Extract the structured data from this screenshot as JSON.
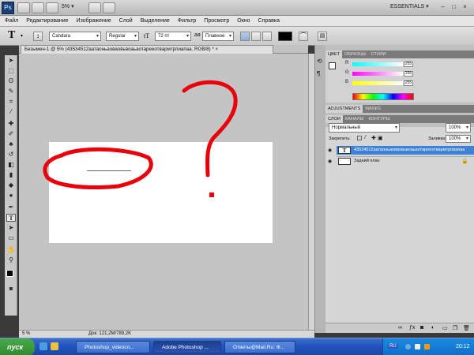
{
  "app_bar": {
    "logo": "Ps",
    "zoom": "5%",
    "workspace": "ESSENTIALS",
    "window_buttons": [
      "–",
      "□",
      "×"
    ]
  },
  "menu": [
    "Файл",
    "Редактирование",
    "Изображение",
    "Слой",
    "Выделение",
    "Фильтр",
    "Просмотр",
    "Окно",
    "Справка"
  ],
  "options_bar": {
    "tool_glyph": "T",
    "font_family": "Candara",
    "font_style": "Regular",
    "size_glyph": "tT",
    "font_size": "72 пт",
    "aa_label": "aa",
    "antialias": "Плавное",
    "text_color_hex": "#000000"
  },
  "document_tab": "Безымен-1 @ 5% (43534512аатаоньаоваовьвоаьаотарееотвармтрпиапаа, RGB/8) *",
  "status": {
    "zoom": "5 %",
    "doc_info": "Док: 121,2M/789,2K"
  },
  "color_panel": {
    "tabs": [
      "ЦВЕТ",
      "ОБРАЗЦЫ",
      "СТИЛИ"
    ],
    "channels": [
      {
        "label": "R",
        "value": "255"
      },
      {
        "label": "G",
        "value": "255"
      },
      {
        "label": "B",
        "value": "255"
      }
    ]
  },
  "adjustments_panel": {
    "tabs": [
      "ADJUSTMENTS",
      "MASKS"
    ]
  },
  "layers_panel": {
    "tabs": [
      "СЛОИ",
      "КАНАЛЫ",
      "КОНТУРЫ"
    ],
    "blend_mode": "Нормальный",
    "opacity": "100%",
    "lock_label": "Закрепить:",
    "fill_label": "Заливка:",
    "fill": "100%",
    "layers": [
      {
        "name": "43534512аатаоньаоваовьвоаьаотарееотвармтрпиапаа",
        "thumb": "T",
        "selected": true
      },
      {
        "name": "Задний план",
        "thumb": "",
        "selected": false
      }
    ]
  },
  "taskbar": {
    "start": "пуск",
    "tasks": [
      {
        "label": "Photoshop_videoco...",
        "active": false
      },
      {
        "label": "Adobe Photoshop ...",
        "active": true
      },
      {
        "label": "Ответы@Mail.Ru: Ф...",
        "active": false
      }
    ],
    "language": "RU",
    "clock": "20:12"
  },
  "annotation_glyph": "?"
}
